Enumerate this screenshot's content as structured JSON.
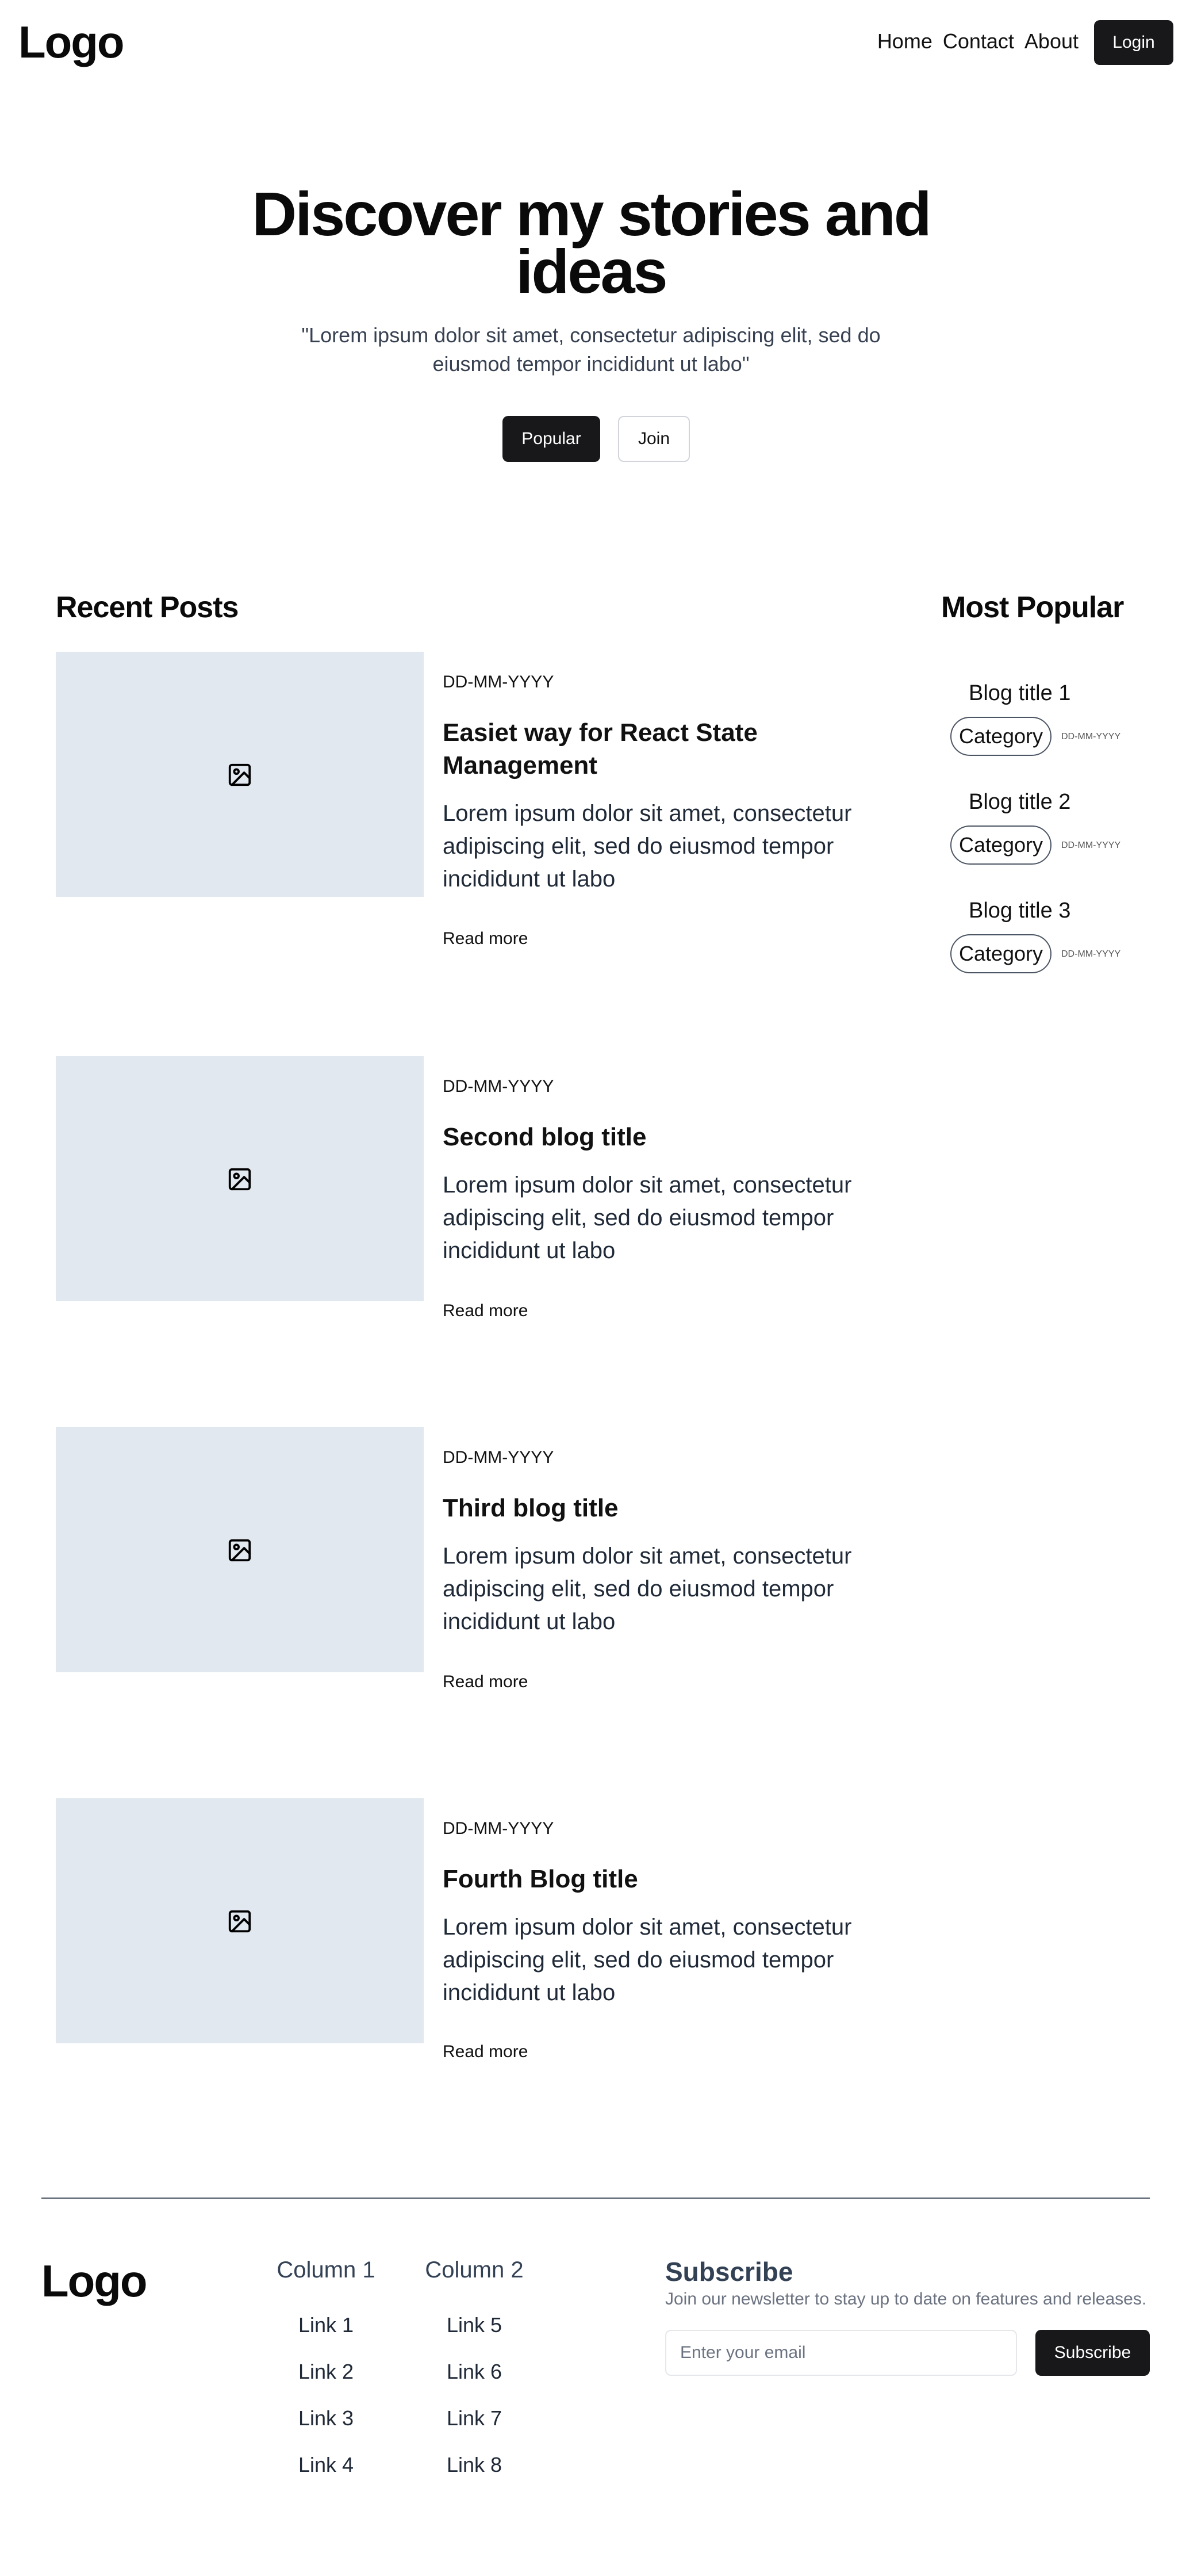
{
  "header": {
    "logo": "Logo",
    "nav": [
      "Home",
      "Contact",
      "About"
    ],
    "login_label": "Login"
  },
  "hero": {
    "title": "Discover my stories and ideas",
    "subtitle": "\"Lorem ipsum dolor sit amet, consectetur adipiscing elit, sed do eiusmod tempor incididunt ut labo\"",
    "popular_label": "Popular",
    "join_label": "Join"
  },
  "recent": {
    "heading": "Recent Posts",
    "icon": "image-icon",
    "posts": [
      {
        "date": "DD-MM-YYYY",
        "title": "Easiet way for React State Management",
        "excerpt": "Lorem ipsum dolor sit amet, consectetur adipiscing elit, sed do eiusmod tempor incididunt ut labo",
        "read_more": "Read more"
      },
      {
        "date": "DD-MM-YYYY",
        "title": "Second blog title",
        "excerpt": "Lorem ipsum dolor sit amet, consectetur adipiscing elit, sed do eiusmod tempor incididunt ut labo",
        "read_more": "Read more"
      },
      {
        "date": "DD-MM-YYYY",
        "title": "Third blog title",
        "excerpt": "Lorem ipsum dolor sit amet, consectetur adipiscing elit, sed do eiusmod tempor incididunt ut labo",
        "read_more": "Read more"
      },
      {
        "date": "DD-MM-YYYY",
        "title": "Fourth Blog title",
        "excerpt": "Lorem ipsum dolor sit amet, consectetur adipiscing elit, sed do eiusmod tempor incididunt ut labo",
        "read_more": "Read more"
      }
    ]
  },
  "popular": {
    "heading": "Most Popular",
    "items": [
      {
        "title": "Blog title 1",
        "category": "Category",
        "date": "DD-MM-YYYY"
      },
      {
        "title": "Blog title 2",
        "category": "Category",
        "date": "DD-MM-YYYY"
      },
      {
        "title": "Blog title 3",
        "category": "Category",
        "date": "DD-MM-YYYY"
      }
    ]
  },
  "footer": {
    "logo": "Logo",
    "columns": [
      {
        "heading": "Column 1",
        "links": [
          "Link 1",
          "Link 2",
          "Link 3",
          "Link 4"
        ]
      },
      {
        "heading": "Column 2",
        "links": [
          "Link 5",
          "Link 6",
          "Link 7",
          "Link 8"
        ]
      }
    ],
    "subscribe": {
      "title": "Subscribe",
      "description": "Join our newsletter to stay up to date on features and releases.",
      "placeholder": "Enter your email",
      "button_label": "Subscribe"
    }
  }
}
